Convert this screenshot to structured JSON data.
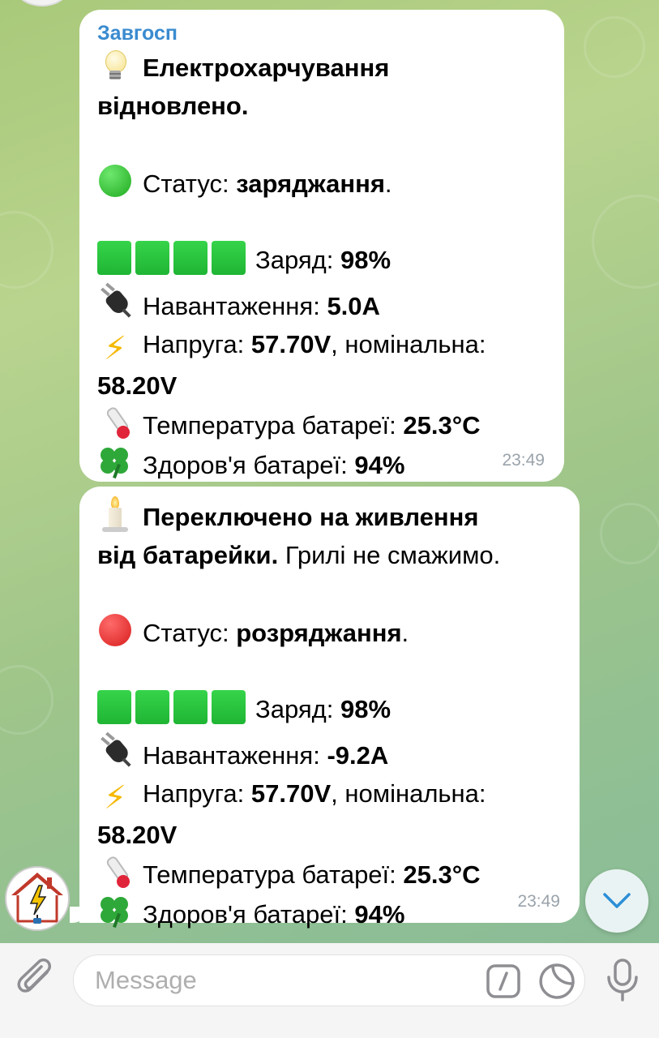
{
  "messages": [
    {
      "sender": "Завгосп",
      "headline": "Електрохарчування",
      "headline2": "відновлено.",
      "status_label": "Статус: ",
      "status_value": "заряджання",
      "status_end": ".",
      "charge_label": "Заряд: ",
      "charge_value": "98%",
      "load_label": "Навантаження: ",
      "load_value": "5.0A",
      "voltage_label": "Напруга: ",
      "voltage_value": "57.70V",
      "nominal_label": ", номінальна:",
      "nominal_value": "58.20V",
      "temp_label": "Температура батареї: ",
      "temp_value": "25.3°C",
      "health_label": "Здоров'я батареї: ",
      "health_value": "94%",
      "time": "23:49"
    },
    {
      "headline": "Переключено на живлення",
      "headline2_bold": "від батарейки.",
      "headline2_rest": " Грилі не смажимо.",
      "status_label": "Статус: ",
      "status_value": "розряджання",
      "status_end": ".",
      "charge_label": "Заряд: ",
      "charge_value": "98%",
      "load_label": "Навантаження: ",
      "load_value": "-9.2A",
      "voltage_label": "Напруга: ",
      "voltage_value": "57.70V",
      "nominal_label": ", номінальна:",
      "nominal_value": "58.20V",
      "temp_label": "Температура батареї: ",
      "temp_value": "25.3°C",
      "health_label": "Здоров'я батареї: ",
      "health_value": "94%",
      "time": "23:49"
    }
  ],
  "composer": {
    "placeholder": "Message"
  },
  "icons": {
    "attach": "paperclip-icon",
    "commands": "slash-command-icon",
    "sticker": "sticker-icon",
    "mic": "microphone-icon",
    "scroll": "chevron-down-icon",
    "avatar": "house-lightning-plug-icon"
  },
  "colors": {
    "sender": "#3a8bd0",
    "battery_bar": "#1fb534",
    "status_charging": "#1faa1f",
    "status_discharging": "#d81e1e"
  }
}
